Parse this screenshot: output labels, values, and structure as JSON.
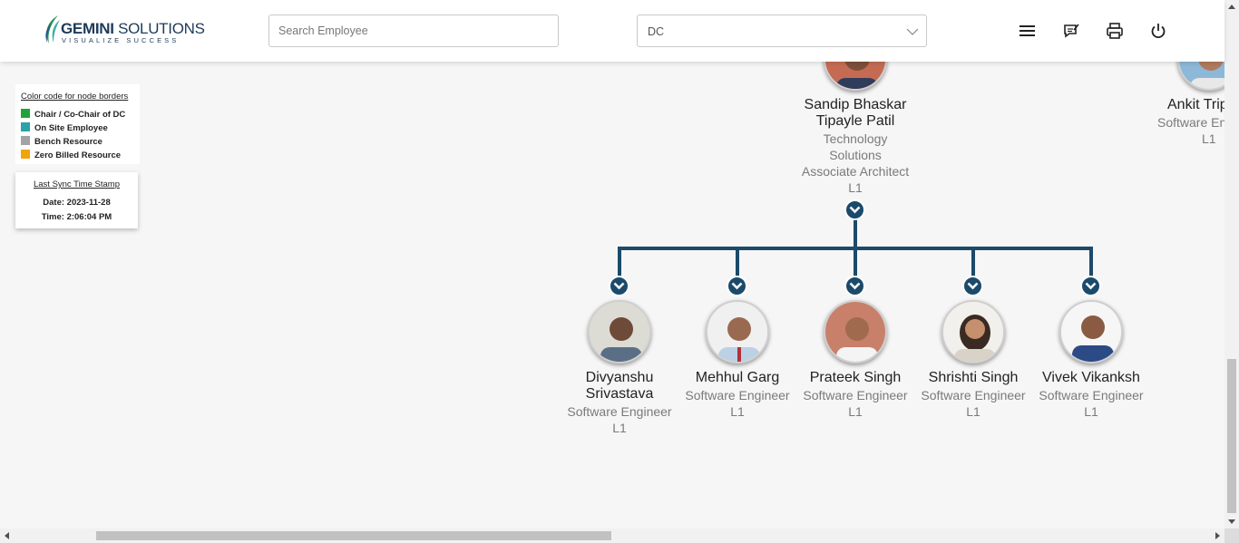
{
  "header": {
    "logo_brand_bold": "GEMINI",
    "logo_brand_rest": "SOLUTIONS",
    "logo_tagline": "VISUALIZE SUCCESS",
    "search_placeholder": "Search Employee",
    "department_select_value": "DC",
    "icons": [
      "menu-icon",
      "feedback-icon",
      "print-icon",
      "power-icon"
    ]
  },
  "legend": {
    "title": "Color code for node borders",
    "items": [
      {
        "label": "Chair / Co-Chair of DC",
        "color": "#22a33a"
      },
      {
        "label": "On Site Employee",
        "color": "#2aa2a6"
      },
      {
        "label": "Bench Resource",
        "color": "#a3a3a3"
      },
      {
        "label": "Zero Billed Resource",
        "color": "#f0a30a"
      }
    ]
  },
  "sync": {
    "title": "Last Sync Time Stamp",
    "date": "Date: 2023-11-28",
    "time": "Time: 2:06:04 PM"
  },
  "tree": {
    "connector_color": "#1b4a6b",
    "parent": {
      "name_line1": "Sandip Bhaskar",
      "name_line2": "Tipayle Patil",
      "dept_line1": "Technology",
      "dept_line2": "Solutions",
      "role": "Associate Architect",
      "level": "L1"
    },
    "side_node": {
      "name": "Ankit Trip",
      "role": "Software En",
      "level": "L1"
    },
    "children": [
      {
        "name_line1": "Divyanshu",
        "name_line2": "Srivastava",
        "role": "Software Engineer",
        "level": "L1"
      },
      {
        "name_line1": "Mehhul Garg",
        "name_line2": "",
        "role": "Software Engineer",
        "level": "L1"
      },
      {
        "name_line1": "Prateek Singh",
        "name_line2": "",
        "role": "Software Engineer",
        "level": "L1"
      },
      {
        "name_line1": "Shrishti Singh",
        "name_line2": "",
        "role": "Software Engineer",
        "level": "L1"
      },
      {
        "name_line1": "Vivek Vikanksh",
        "name_line2": "",
        "role": "Software Engineer",
        "level": "L1"
      }
    ]
  }
}
